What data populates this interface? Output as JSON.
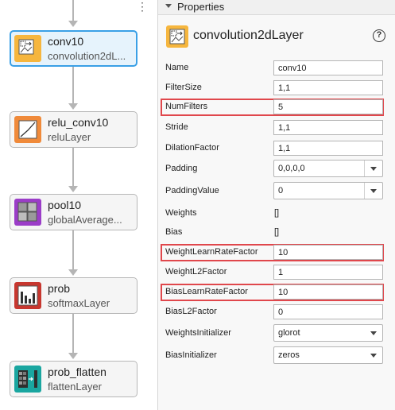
{
  "canvas": {
    "nodes": [
      {
        "name": "conv10",
        "type": "convolution2dL...",
        "icon": "convolution-icon",
        "color": "#f6b63e",
        "selected": true
      },
      {
        "name": "relu_conv10",
        "type": "reluLayer",
        "icon": "relu-icon",
        "color": "#f08a3a",
        "selected": false
      },
      {
        "name": "pool10",
        "type": "globalAverage...",
        "icon": "pooling-icon",
        "color": "#9b3dc8",
        "selected": false
      },
      {
        "name": "prob",
        "type": "softmaxLayer",
        "icon": "softmax-icon",
        "color": "#c7372f",
        "selected": false
      },
      {
        "name": "prob_flatten",
        "type": "flattenLayer",
        "icon": "flatten-icon",
        "color": "#1aa6a0",
        "selected": false
      }
    ]
  },
  "panel": {
    "title": "Properties",
    "layer_type": "convolution2dLayer",
    "help_label": "?",
    "properties": [
      {
        "label": "Name",
        "value": "conv10",
        "kind": "text",
        "highlight": false
      },
      {
        "label": "FilterSize",
        "value": "1,1",
        "kind": "text",
        "highlight": false
      },
      {
        "label": "NumFilters",
        "value": "5",
        "kind": "text",
        "highlight": true
      },
      {
        "label": "Stride",
        "value": "1,1",
        "kind": "text",
        "highlight": false
      },
      {
        "label": "DilationFactor",
        "value": "1,1",
        "kind": "text",
        "highlight": false
      },
      {
        "label": "Padding",
        "value": "0,0,0,0",
        "kind": "combo",
        "highlight": false
      },
      {
        "label": "PaddingValue",
        "value": "0",
        "kind": "combo",
        "highlight": false
      },
      {
        "label": "Weights",
        "value": "[]",
        "kind": "static",
        "highlight": false
      },
      {
        "label": "Bias",
        "value": "[]",
        "kind": "static",
        "highlight": false
      },
      {
        "label": "WeightLearnRateFactor",
        "value": "10",
        "kind": "text",
        "highlight": true
      },
      {
        "label": "WeightL2Factor",
        "value": "1",
        "kind": "text",
        "highlight": false
      },
      {
        "label": "BiasLearnRateFactor",
        "value": "10",
        "kind": "text",
        "highlight": true
      },
      {
        "label": "BiasL2Factor",
        "value": "0",
        "kind": "text",
        "highlight": false
      },
      {
        "label": "WeightsInitializer",
        "value": "glorot",
        "kind": "dropdown",
        "highlight": false
      },
      {
        "label": "BiasInitializer",
        "value": "zeros",
        "kind": "dropdown",
        "highlight": false
      }
    ]
  },
  "colors": {
    "selection": "#3aa0e6",
    "highlight": "#e0474c"
  }
}
